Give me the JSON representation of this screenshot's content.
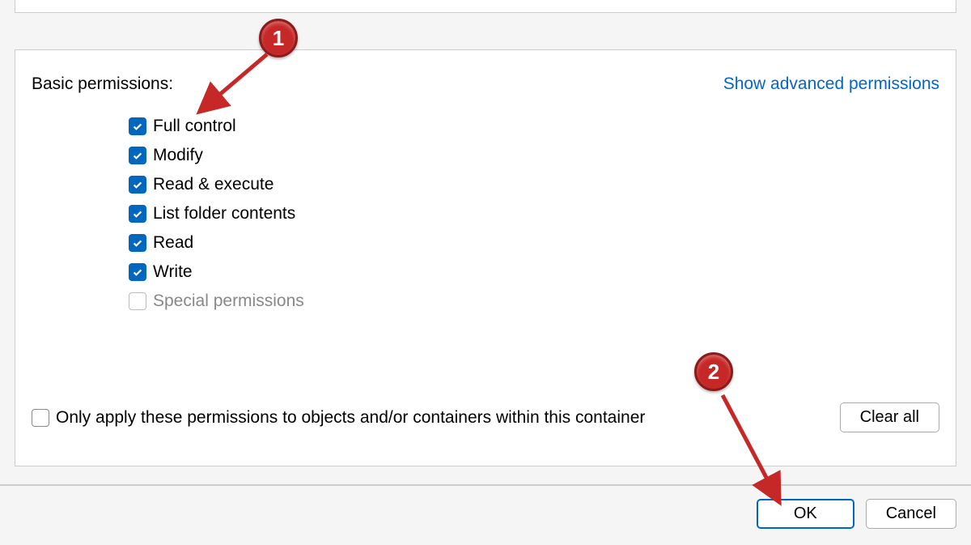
{
  "section_label": "Basic permissions:",
  "advanced_link": "Show advanced permissions",
  "permissions": [
    {
      "label": "Full control",
      "checked": true,
      "disabled": false
    },
    {
      "label": "Modify",
      "checked": true,
      "disabled": false
    },
    {
      "label": "Read & execute",
      "checked": true,
      "disabled": false
    },
    {
      "label": "List folder contents",
      "checked": true,
      "disabled": false
    },
    {
      "label": "Read",
      "checked": true,
      "disabled": false
    },
    {
      "label": "Write",
      "checked": true,
      "disabled": false
    },
    {
      "label": "Special permissions",
      "checked": false,
      "disabled": true
    }
  ],
  "only_apply": {
    "label": "Only apply these permissions to objects and/or containers within this container",
    "checked": false
  },
  "clear_all": "Clear all",
  "ok": "OK",
  "cancel": "Cancel",
  "annotations": {
    "badge1": "1",
    "badge2": "2"
  }
}
